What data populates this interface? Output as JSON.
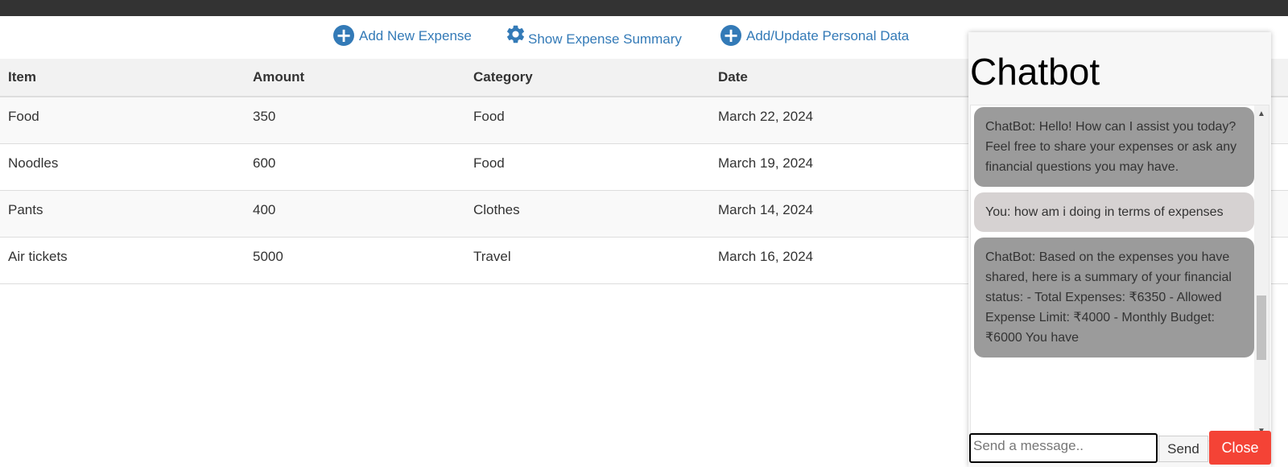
{
  "actions": {
    "add_expense": "Add New Expense",
    "show_summary": "Show Expense Summary",
    "add_personal": "Add/Update Personal Data"
  },
  "table": {
    "headers": [
      "Item",
      "Amount",
      "Category",
      "Date"
    ],
    "rows": [
      [
        "Food",
        "350",
        "Food",
        "March 22, 2024"
      ],
      [
        "Noodles",
        "600",
        "Food",
        "March 19, 2024"
      ],
      [
        "Pants",
        "400",
        "Clothes",
        "March 14, 2024"
      ],
      [
        "Air tickets",
        "5000",
        "Travel",
        "March 16, 2024"
      ]
    ]
  },
  "chatbot": {
    "title": "Chatbot",
    "messages": [
      {
        "sender": "bot",
        "text": "ChatBot: Hello! How can I assist you today? Feel free to share your expenses or ask any financial questions you may have."
      },
      {
        "sender": "user",
        "text": "You: how am i doing in terms of expenses"
      },
      {
        "sender": "bot",
        "text": "ChatBot: Based on the expenses you have shared, here is a summary of your financial status: - Total Expenses: ₹6350 - Allowed Expense Limit: ₹4000 - Monthly Budget: ₹6000 You have"
      }
    ],
    "input_placeholder": "Send a message..",
    "send_label": "Send",
    "close_label": "Close"
  },
  "colors": {
    "topbar": "#333333",
    "link": "#337ab7",
    "bot_bubble": "#9b9b9b",
    "user_bubble": "#d6d2d2",
    "close_button": "#f44336"
  },
  "icons": {
    "add_expense": "plus-circle-icon",
    "show_summary": "gear-icon",
    "add_personal": "plus-circle-icon"
  }
}
